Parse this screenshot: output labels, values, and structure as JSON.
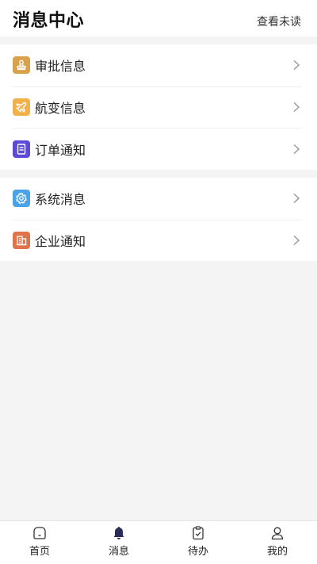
{
  "header": {
    "title": "消息中心",
    "action_label": "查看未读"
  },
  "groups": [
    {
      "items": [
        {
          "label": "审批信息",
          "icon": "stamp-icon",
          "color": "#d9a24a"
        },
        {
          "label": "航变信息",
          "icon": "airplane-icon",
          "color": "#f2b24b"
        },
        {
          "label": "订单通知",
          "icon": "document-icon",
          "color": "#5b4bd6"
        }
      ]
    },
    {
      "items": [
        {
          "label": "系统消息",
          "icon": "gear-icon",
          "color": "#4aa3e8"
        },
        {
          "label": "企业通知",
          "icon": "building-icon",
          "color": "#e0734a"
        }
      ]
    }
  ],
  "tabbar": {
    "active_color": "#2a2d5c",
    "tabs": [
      {
        "label": "首页",
        "icon": "home-icon",
        "active": false
      },
      {
        "label": "消息",
        "icon": "bell-icon",
        "active": true
      },
      {
        "label": "待办",
        "icon": "clipboard-icon",
        "active": false
      },
      {
        "label": "我的",
        "icon": "user-icon",
        "active": false
      }
    ]
  }
}
